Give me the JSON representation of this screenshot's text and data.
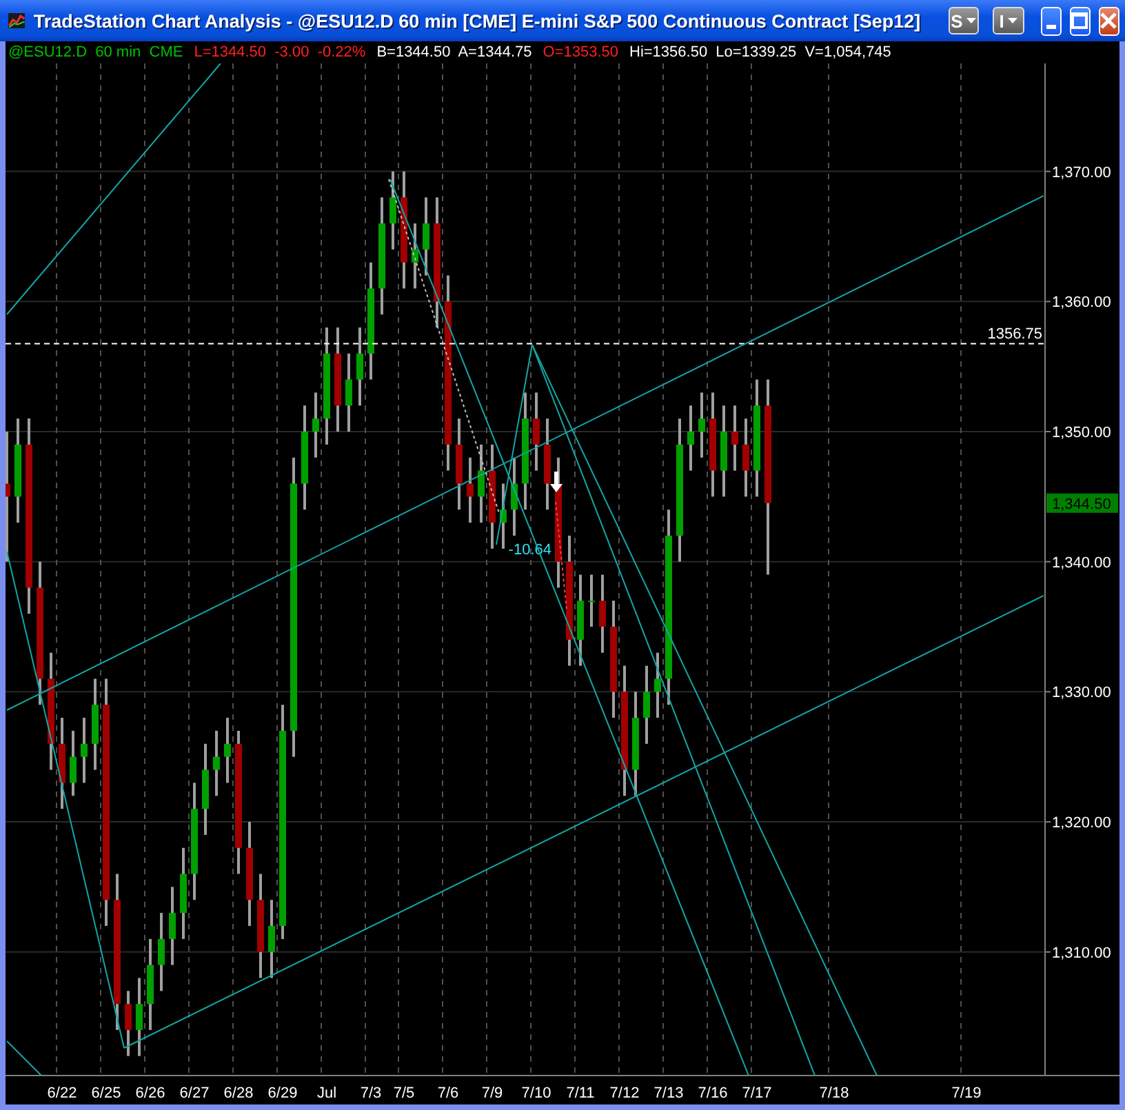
{
  "window": {
    "title": "TradeStation Chart Analysis - @ESU12.D 60 min [CME] E-mini S&P 500 Continuous Contract [Sep12]",
    "menu_buttons": [
      {
        "label": "S"
      },
      {
        "label": "I"
      }
    ]
  },
  "info_line": [
    {
      "text": "@ESU12.D  60 min  CME",
      "color": "#00c000"
    },
    {
      "text": "L=1344.50  -3.00  -0.22%",
      "color": "#ff2020"
    },
    {
      "text": "B=1344.50  A=1344.75",
      "color": "#ffffff"
    },
    {
      "text": "O=1353.50",
      "color": "#ff2020"
    },
    {
      "text": "Hi=1356.50  Lo=1339.25  V=1,054,745",
      "color": "#ffffff"
    }
  ],
  "chart": {
    "last_price": "1,344.50",
    "chart_data": {
      "type": "candlestick",
      "grid": true,
      "ylim": [
        1300.5,
        1378.3
      ],
      "yticks": [
        {
          "value": 1310,
          "label": "1,310.00"
        },
        {
          "value": 1320,
          "label": "1,320.00"
        },
        {
          "value": 1330,
          "label": "1,330.00"
        },
        {
          "value": 1340,
          "label": "1,340.00"
        },
        {
          "value": 1350,
          "label": "1,350.00"
        },
        {
          "value": 1360,
          "label": "1,360.00"
        },
        {
          "value": 1370,
          "label": "1,370.00"
        }
      ],
      "categories": [
        null,
        null,
        null,
        null,
        null,
        "6/22",
        null,
        null,
        null,
        "6/25",
        null,
        null,
        null,
        "6/26",
        null,
        null,
        null,
        "6/27",
        null,
        null,
        null,
        "6/28",
        null,
        null,
        null,
        "6/29",
        null,
        null,
        null,
        "Jul",
        null,
        null,
        null,
        "7/3",
        null,
        null,
        "7/5",
        null,
        null,
        null,
        "7/6",
        null,
        null,
        null,
        "7/9",
        null,
        null,
        null,
        "7/10",
        null,
        null,
        null,
        "7/11",
        null,
        null,
        null,
        "7/12",
        null,
        null,
        null,
        "7/13",
        null,
        null,
        null,
        "7/16",
        null,
        null,
        null,
        "7/17",
        null,
        null,
        null,
        null,
        null,
        null,
        "7/18",
        null,
        null,
        null,
        null,
        null,
        null,
        null,
        null,
        null,
        null,
        null,
        "7/19",
        null,
        null,
        null,
        null,
        null,
        null
      ],
      "ohlc": [
        [
          1346,
          1350,
          1340,
          1345
        ],
        [
          1345,
          1351,
          1343,
          1349
        ],
        [
          1349,
          1351,
          1336,
          1338
        ],
        [
          1338,
          1340,
          1329,
          1331
        ],
        [
          1331,
          1333,
          1324,
          1326
        ],
        [
          1326,
          1328,
          1321,
          1323
        ],
        [
          1323,
          1327,
          1322,
          1325
        ],
        [
          1325,
          1328,
          1323,
          1326
        ],
        [
          1326,
          1331,
          1324,
          1329
        ],
        [
          1329,
          1331,
          1312,
          1314
        ],
        [
          1314,
          1316,
          1304,
          1306
        ],
        [
          1306,
          1307,
          1302,
          1304
        ],
        [
          1304,
          1308,
          1302,
          1306
        ],
        [
          1306,
          1311,
          1304,
          1309
        ],
        [
          1309,
          1313,
          1307,
          1311
        ],
        [
          1311,
          1315,
          1309,
          1313
        ],
        [
          1313,
          1318,
          1311,
          1316
        ],
        [
          1316,
          1323,
          1314,
          1321
        ],
        [
          1321,
          1326,
          1319,
          1324
        ],
        [
          1324,
          1327,
          1322,
          1325
        ],
        [
          1325,
          1328,
          1323,
          1326
        ],
        [
          1326,
          1327,
          1316,
          1318
        ],
        [
          1318,
          1320,
          1312,
          1314
        ],
        [
          1314,
          1316,
          1308,
          1310
        ],
        [
          1310,
          1314,
          1308,
          1312
        ],
        [
          1312,
          1329,
          1311,
          1327
        ],
        [
          1327,
          1348,
          1325,
          1346
        ],
        [
          1346,
          1352,
          1344,
          1350
        ],
        [
          1350,
          1353,
          1348,
          1351
        ],
        [
          1351,
          1358,
          1349,
          1356
        ],
        [
          1356,
          1358,
          1350,
          1352
        ],
        [
          1352,
          1356,
          1350,
          1354
        ],
        [
          1354,
          1358,
          1352,
          1356
        ],
        [
          1356,
          1363,
          1354,
          1361
        ],
        [
          1361,
          1368,
          1359,
          1366
        ],
        [
          1366,
          1370,
          1364,
          1368
        ],
        [
          1368,
          1370,
          1361,
          1363
        ],
        [
          1363,
          1366,
          1361,
          1364
        ],
        [
          1364,
          1368,
          1362,
          1366
        ],
        [
          1366,
          1368,
          1358,
          1360
        ],
        [
          1360,
          1362,
          1347,
          1349
        ],
        [
          1349,
          1351,
          1344,
          1346
        ],
        [
          1346,
          1348,
          1343,
          1345
        ],
        [
          1345,
          1349,
          1343,
          1347
        ],
        [
          1347,
          1349,
          1341,
          1343
        ],
        [
          1343,
          1346,
          1341,
          1344
        ],
        [
          1344,
          1348,
          1342,
          1346
        ],
        [
          1346,
          1353,
          1344,
          1351
        ],
        [
          1351,
          1353,
          1347,
          1349
        ],
        [
          1349,
          1351,
          1344,
          1346
        ],
        [
          1346,
          1348,
          1338,
          1340
        ],
        [
          1340,
          1342,
          1332,
          1334
        ],
        [
          1334,
          1339,
          1332,
          1337
        ],
        [
          1337,
          1339,
          1335,
          1337
        ],
        [
          1337,
          1339,
          1333,
          1335
        ],
        [
          1335,
          1337,
          1328,
          1330
        ],
        [
          1330,
          1332,
          1322,
          1324
        ],
        [
          1324,
          1330,
          1322,
          1328
        ],
        [
          1328,
          1332,
          1326,
          1330
        ],
        [
          1330,
          1333,
          1328,
          1331
        ],
        [
          1331,
          1344,
          1329,
          1342
        ],
        [
          1342,
          1351,
          1340,
          1349
        ],
        [
          1349,
          1352,
          1347,
          1350
        ],
        [
          1350,
          1353,
          1348,
          1351
        ],
        [
          1351,
          1353,
          1345,
          1347
        ],
        [
          1347,
          1352,
          1345,
          1350
        ],
        [
          1350,
          1352,
          1347,
          1349
        ],
        [
          1349,
          1351,
          1345,
          1347
        ],
        [
          1347,
          1354,
          1345,
          1352
        ],
        [
          1352,
          1354,
          1339,
          1344.5
        ],
        null,
        null,
        null,
        null,
        null,
        null,
        null,
        null,
        null,
        null,
        null,
        null,
        null,
        null,
        null,
        null,
        null,
        null,
        null,
        null,
        null,
        null,
        null,
        null
      ],
      "ref_lines": [
        {
          "axis": "y",
          "value": 1356.75,
          "label": "1356.75"
        }
      ],
      "annotations": [
        {
          "text": "-10.64"
        }
      ]
    }
  }
}
